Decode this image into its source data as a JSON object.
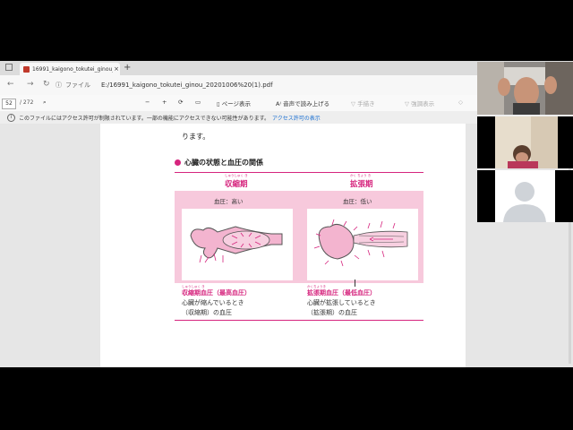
{
  "tab": {
    "title": "16991_kaigono_tokutei_ginou_2…",
    "close": "×",
    "new_tab": "+"
  },
  "address": {
    "file_label": "ファイル",
    "url": "E:/16991_kaigono_tokutei_ginou_20201006%20(1).pdf"
  },
  "toolbar": {
    "page_current": "52",
    "page_total": "/ 272",
    "minus": "−",
    "plus": "+",
    "page_view": "ページ表示",
    "read_aloud": "音声で読み上げる",
    "draw": "手描き",
    "highlight": "強調表示"
  },
  "notice": {
    "text": "このファイルにはアクセス許可が制限されています。一部の機能にアクセスできない可能性があります。",
    "link": "アクセス許可の表示"
  },
  "pdf": {
    "line_top": "ります。",
    "heading": "心臓の状態と血圧の関係",
    "left": {
      "ruby": "しゅうしゅく き",
      "title": "収縮期",
      "bp": "血圧：高い",
      "cap_ruby": "しゅうしゅく き",
      "cap_title": "収縮期血圧（最高血圧）",
      "cap_line1": "心臓が縮んでいるとき",
      "cap_line2": "（収縮期）の血圧"
    },
    "right": {
      "ruby": "かく ちょう き",
      "title": "拡張期",
      "bp": "血圧：低い",
      "cap_ruby": "かくちょうき",
      "cap_title": "拡張期血圧（最低血圧）",
      "cap_line1": "心臓が拡張しているとき",
      "cap_line2": "（拡張期）の血圧"
    }
  },
  "colors": {
    "accent": "#d6257e",
    "diagram_bg": "#f7c9dc",
    "heart": "#f3b4cf"
  },
  "icons": [
    "back-icon",
    "forward-icon",
    "refresh-icon",
    "info-icon",
    "search-icon",
    "rotate-icon",
    "fit-icon",
    "read-aloud-icon",
    "draw-icon",
    "highlight-icon",
    "eraser-icon"
  ]
}
